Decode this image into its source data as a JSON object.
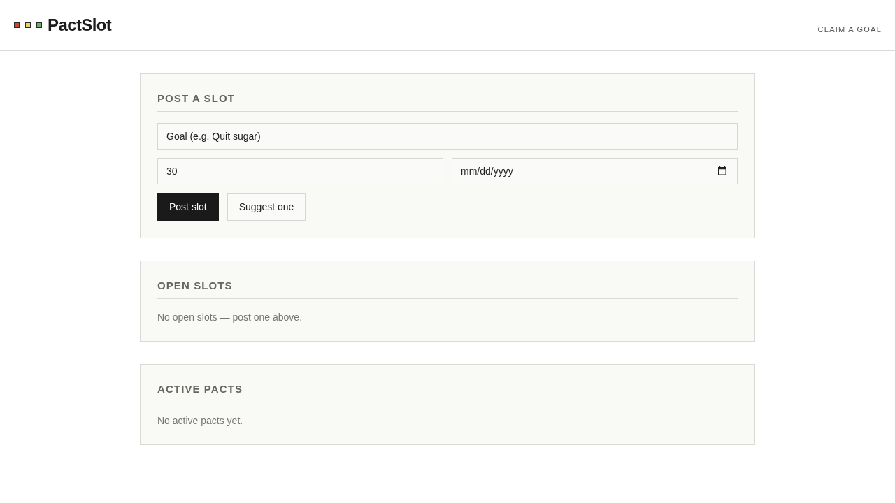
{
  "header": {
    "logo_marks": [
      {
        "color": "#c8463c"
      },
      {
        "color": "#e6d46a"
      },
      {
        "color": "#6caf6c"
      }
    ],
    "brand": "PactSlot",
    "nav_link": "CLAIM A GOAL"
  },
  "post_slot": {
    "title": "POST A SLOT",
    "goal_field": {
      "placeholder": "Goal (e.g. Quit sugar)"
    },
    "number_field": {
      "value": "30"
    },
    "date_field": {
      "placeholder": "mm/dd/yyyy"
    },
    "buttons": [
      {
        "label": "Post slot",
        "kind": "primary"
      },
      {
        "label": "Suggest one",
        "kind": "secondary"
      }
    ]
  },
  "open_slots": {
    "title": "OPEN SLOTS",
    "empty_message": "No open slots — post one above."
  },
  "active_pacts": {
    "title": "ACTIVE PACTS",
    "empty_message": "No active pacts yet."
  }
}
